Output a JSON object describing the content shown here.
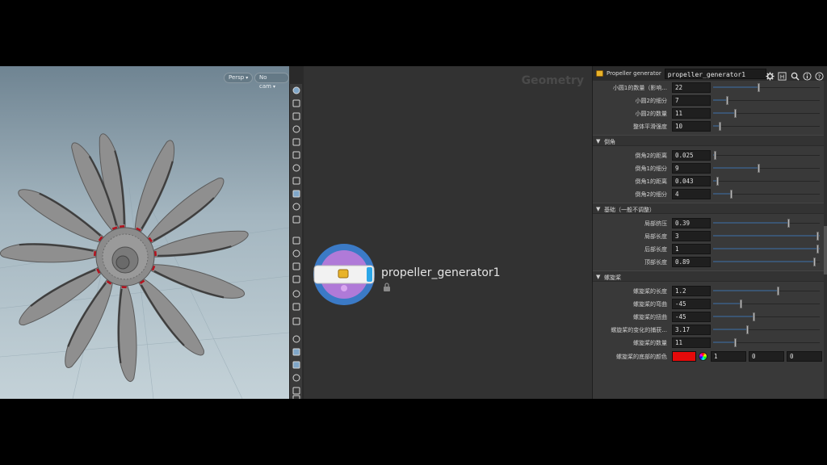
{
  "viewport": {
    "persp_label": "Persp",
    "cam_label": "No cam"
  },
  "network": {
    "context_title": "Geometry",
    "node_name": "propeller_generator1"
  },
  "params": {
    "node_type": "Propeller generator",
    "node_name": "propeller_generator1",
    "top_rows": [
      {
        "label": "小圆1的数量（影响...",
        "value": "22",
        "frac": 0.42
      },
      {
        "label": "小圆2的细分",
        "value": "7",
        "frac": 0.12
      },
      {
        "label": "小圆2的数量",
        "value": "11",
        "frac": 0.2
      },
      {
        "label": "整体平滑强度",
        "value": "10",
        "frac": 0.05
      }
    ],
    "sections": [
      {
        "title": "倒角",
        "rows": [
          {
            "label": "倒角2的距离",
            "value": "0.025",
            "frac": 0.01
          },
          {
            "label": "倒角1的细分",
            "value": "9",
            "frac": 0.42
          },
          {
            "label": "倒角1的距离",
            "value": "0.043",
            "frac": 0.03
          },
          {
            "label": "倒角2的细分",
            "value": "4",
            "frac": 0.16
          }
        ]
      },
      {
        "title": "基础（一般不调整）",
        "rows": [
          {
            "label": "局部挤压",
            "value": "0.39",
            "frac": 0.7
          },
          {
            "label": "局部长度",
            "value": "3",
            "frac": 1.0
          },
          {
            "label": "后部长度",
            "value": "1",
            "frac": 1.0
          },
          {
            "label": "顶部长度",
            "value": "0.89",
            "frac": 0.94
          }
        ]
      },
      {
        "title": "螺旋桨",
        "rows": [
          {
            "label": "螺旋桨的长度",
            "value": "1.2",
            "frac": 0.6
          },
          {
            "label": "螺旋桨的弯曲",
            "value": "-45",
            "frac": 0.25
          },
          {
            "label": "螺旋桨的扭曲",
            "value": "-45",
            "frac": 0.37
          },
          {
            "label": "螺旋桨的变化的捕获...",
            "value": "3.17",
            "frac": 0.31
          },
          {
            "label": "螺旋桨的数量",
            "value": "11",
            "frac": 0.2
          }
        ]
      }
    ],
    "color_row": {
      "label": "螺旋桨的底部的颜色",
      "swatch": "#e50a0a",
      "r": "1",
      "g": "0",
      "b": "0"
    }
  }
}
